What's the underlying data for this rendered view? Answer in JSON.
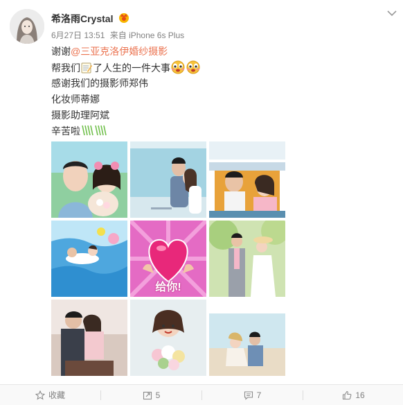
{
  "post": {
    "username": "希洛雨Crystal",
    "date": "6月27日 13:51",
    "source": "来自 iPhone 6s Plus",
    "lines": {
      "thanks_prefix": "谢谢",
      "mention": "@三亚克洛伊婚纱摄影",
      "help_prefix": "帮我们",
      "help_suffix": "了人生的一件大事",
      "photographer": "感谢我们的摄影师郑伟",
      "makeup": "化妆师蒂娜",
      "assistant": "摄影助理阿斌",
      "hardwork": "辛苦啦"
    },
    "icons": [
      "vip-crown-icon",
      "chevron-down-icon",
      "memo-emoji-icon",
      "crying-emoji-icon",
      "applause-emoji-icon"
    ],
    "photos": [
      "wedding-photo-1",
      "wedding-photo-2",
      "wedding-photo-3",
      "wedding-photo-4",
      "wedding-photo-5",
      "wedding-photo-6",
      "wedding-photo-7",
      "wedding-photo-8",
      "wedding-photo-9"
    ],
    "heart_caption": "给你!"
  },
  "toolbar": {
    "favorite_label": "收藏",
    "repost_count": "5",
    "comment_count": "7",
    "like_count": "16"
  },
  "colors": {
    "mention": "#eb7350",
    "text": "#333333",
    "meta": "#808080",
    "heart": "#e8287a"
  }
}
